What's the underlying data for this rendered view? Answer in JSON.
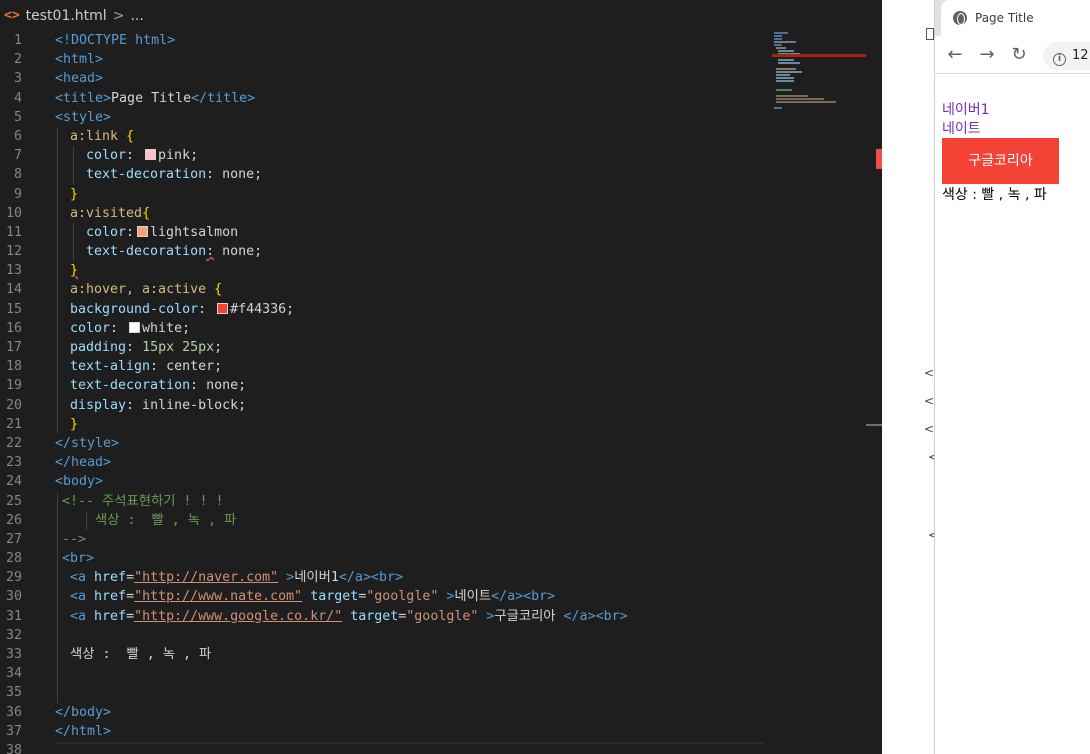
{
  "editor": {
    "breadcrumb": {
      "file_icon": "<>",
      "file_name": "test01.html",
      "separator": ">",
      "ellipsis": "..."
    },
    "code_lines": [
      {
        "n": "1",
        "indent": 0
      },
      {
        "n": "2"
      },
      {
        "n": "3"
      },
      {
        "n": "4"
      },
      {
        "n": "5"
      },
      {
        "n": "6"
      },
      {
        "n": "7"
      },
      {
        "n": "8"
      },
      {
        "n": "9"
      },
      {
        "n": "10"
      },
      {
        "n": "11"
      },
      {
        "n": "12"
      },
      {
        "n": "13"
      },
      {
        "n": "14"
      },
      {
        "n": "15"
      },
      {
        "n": "16"
      },
      {
        "n": "17"
      },
      {
        "n": "18"
      },
      {
        "n": "19"
      },
      {
        "n": "20"
      },
      {
        "n": "21"
      },
      {
        "n": "22"
      },
      {
        "n": "23"
      },
      {
        "n": "24"
      },
      {
        "n": "25"
      },
      {
        "n": "26"
      },
      {
        "n": "27"
      },
      {
        "n": "28"
      },
      {
        "n": "29"
      },
      {
        "n": "30"
      },
      {
        "n": "31"
      },
      {
        "n": "32"
      },
      {
        "n": "33"
      },
      {
        "n": "34"
      },
      {
        "n": "35"
      },
      {
        "n": "36"
      },
      {
        "n": "37"
      },
      {
        "n": "38"
      }
    ],
    "code": {
      "l1": [
        "<!DOCTYPE ",
        "html",
        ">"
      ],
      "l2": "<html>",
      "l3": "<head>",
      "l4": [
        "<title>",
        "Page Title",
        "</title>"
      ],
      "l5": "<style>",
      "l6": [
        "a:link ",
        "{"
      ],
      "l7": [
        "color",
        ": ",
        "pink",
        ";"
      ],
      "l8": [
        "text-decoration",
        ": none;"
      ],
      "l9": "}",
      "l10": [
        "a:visited",
        "{"
      ],
      "l11": [
        "color",
        ":",
        "lightsalmon"
      ],
      "l12": [
        "text-decoration",
        ":",
        " none;"
      ],
      "l13": "}",
      "l14": [
        "a:hover, a:active ",
        "{"
      ],
      "l15": [
        "background-color",
        ": ",
        "#f44336",
        ";"
      ],
      "l16": [
        "color",
        ": ",
        "white",
        ";"
      ],
      "l17": [
        "padding",
        ": ",
        "15px 25px",
        ";"
      ],
      "l18": [
        "text-align",
        ": center;"
      ],
      "l19": [
        "text-decoration",
        ": none;"
      ],
      "l20": [
        "display",
        ": inline-block;"
      ],
      "l21": "}",
      "l22": "</style>",
      "l23": "</head>",
      "l24": "<body>",
      "l25": "<!-- 주석표현하기 ! ! !",
      "l26": "색상 :  빨 , 녹 , 파",
      "l27": "-->",
      "l28": "<br>",
      "l29": [
        "<a ",
        "href",
        "=",
        "\"http://naver.com\"",
        " >",
        "네이버1",
        "</a><br>"
      ],
      "l30": [
        "<a ",
        "href",
        "=",
        "\"http://www.nate.com\"",
        " ",
        "target",
        "=",
        "\"goolgle\"",
        " >",
        "네이트",
        "</a><br>"
      ],
      "l31": [
        "<a ",
        "href",
        "=",
        "\"http://www.google.co.kr/\"",
        " ",
        "target",
        "=",
        "\"goolgle\"",
        " >",
        "구글코리아 ",
        "</a><br>"
      ],
      "l33": "색상 :  빨 , 녹 , 파",
      "l36": "</body>",
      "l37": "</html>"
    },
    "colors": {
      "pink": "#ffc0cb",
      "lightsalmon": "#ffa07a",
      "red": "#f44336",
      "white": "#ffffff"
    }
  },
  "browser": {
    "tab_title": "Page Title",
    "tab_icon": "globe-icon",
    "omnibox_text": "12",
    "page": {
      "link1": "네이버1",
      "link2": "네이트",
      "button": "구글코리아",
      "text": "색상 : 빨 , 녹 , 파"
    },
    "link_color": "#7b2ab5",
    "button_color": "#f44336"
  },
  "gap_chars": [
    "<",
    "<",
    "<",
    "<",
    "<"
  ]
}
